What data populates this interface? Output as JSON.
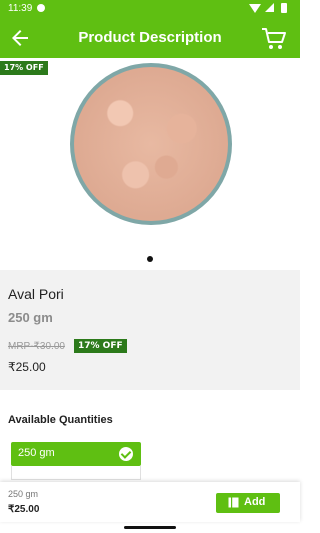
{
  "status_bar": {
    "time": "11:39"
  },
  "header": {
    "title": "Product Description"
  },
  "product": {
    "discount_ribbon": "17% OFF",
    "name": "Aval Pori",
    "weight": "250 gm",
    "mrp": "MRP-₹30.00",
    "discount_badge": "17% OFF",
    "price": "₹25.00"
  },
  "quantities": {
    "heading": "Available Quantities",
    "options": [
      {
        "label": "250 gm"
      }
    ]
  },
  "bottom_bar": {
    "weight": "250 gm",
    "price": "₹25.00",
    "add_label": "Add"
  },
  "colors": {
    "primary": "#5fbf12",
    "discount": "#2c7a1b"
  }
}
